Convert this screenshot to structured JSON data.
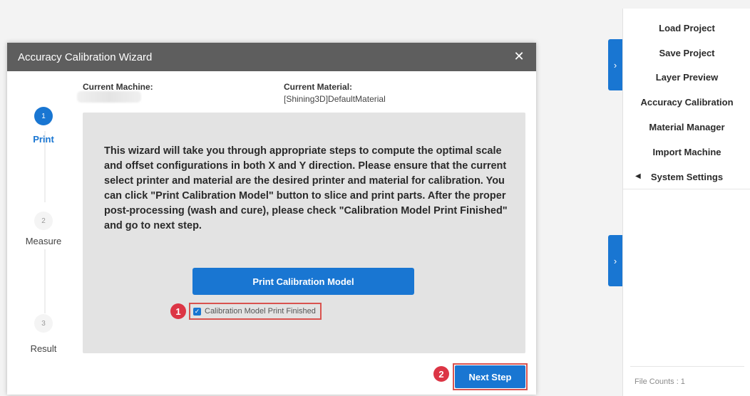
{
  "dialog": {
    "title": "Accuracy Calibration Wizard",
    "close_icon": "close-icon",
    "machine_label": "Current Machine:",
    "material_label": "Current Material:",
    "material_value": "[Shining3D]DefaultMaterial",
    "steps": [
      {
        "number": "1",
        "label": "Print",
        "state": "active"
      },
      {
        "number": "2",
        "label": "Measure",
        "state": "inactive"
      },
      {
        "number": "3",
        "label": "Result",
        "state": "inactive"
      }
    ],
    "description": "This wizard will take you through appropriate steps to compute the optimal scale and offset configurations in both X and Y direction. Please ensure that the current select printer and material are the desired printer and material for calibration. You can click \"Print Calibration Model\" button to slice and print parts. After the proper post-processing (wash and cure), please check \"Calibration Model Print Finished\" and go to next step.",
    "print_button": "Print Calibration Model",
    "checkbox_label": "Calibration Model Print Finished",
    "checkbox_checked": true,
    "next_button": "Next Step",
    "badges": [
      "1",
      "2"
    ]
  },
  "right_panel": {
    "menu": [
      {
        "label": "Load Project"
      },
      {
        "label": "Save Project"
      },
      {
        "label": "Layer Preview"
      },
      {
        "label": "Accuracy Calibration"
      },
      {
        "label": "Material Manager"
      },
      {
        "label": "Import Machine"
      },
      {
        "label": "System Settings",
        "arrow_icon": "triangle-left-icon"
      }
    ],
    "file_counts": "File Counts : 1"
  },
  "colors": {
    "accent": "#1976d2",
    "header": "#5e5e5e",
    "highlight": "#d9534f"
  }
}
